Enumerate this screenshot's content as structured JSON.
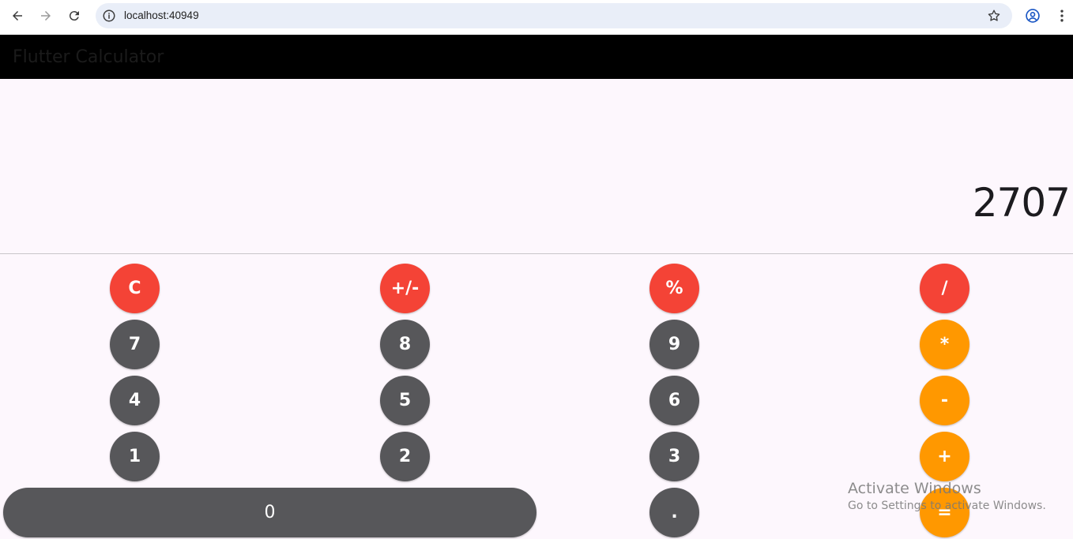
{
  "browser": {
    "url": "localhost:40949",
    "icons": {
      "back": "back-arrow-icon",
      "forward": "forward-arrow-icon",
      "reload": "reload-icon",
      "info": "site-info-icon",
      "bookmark": "star-icon",
      "profile": "profile-icon",
      "menu": "kebab-menu-icon"
    }
  },
  "app": {
    "title": "Flutter Calculator",
    "display_value": "2707"
  },
  "keys": {
    "clear": "C",
    "negate": "+/-",
    "percent": "%",
    "divide": "/",
    "seven": "7",
    "eight": "8",
    "nine": "9",
    "multiply": "*",
    "four": "4",
    "five": "5",
    "six": "6",
    "subtract": "-",
    "one": "1",
    "two": "2",
    "three": "3",
    "add": "+",
    "zero": "0",
    "decimal": ".",
    "equals": "="
  },
  "colors": {
    "function_key": "#f44336",
    "digit_key": "#57575a",
    "operator_key": "#ff9800",
    "app_bar": "#000000",
    "background": "#fdf7fd"
  },
  "watermark": {
    "title": "Activate Windows",
    "subtitle": "Go to Settings to activate Windows."
  }
}
